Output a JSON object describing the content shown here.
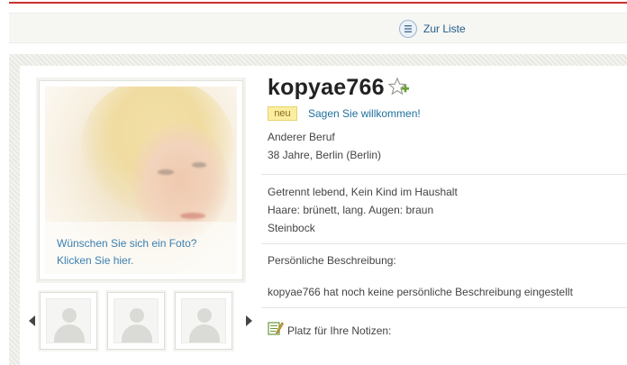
{
  "toolbar": {
    "back_to_list_label": "Zur Liste",
    "icon": "list-icon"
  },
  "profile": {
    "username": "kopyae766",
    "favorite_icon": "star-plus-icon",
    "badge": "neu",
    "welcome_link": "Sagen Sie willkommen!",
    "occupation": "Anderer Beruf",
    "age_location": "38 Jahre, Berlin (Berlin)",
    "family_status": "Getrennt lebend, Kein Kind im Haushalt",
    "appearance": "Haare: brünett, lang. Augen: braun",
    "zodiac": "Steinbock",
    "description_heading": "Persönliche Beschreibung:",
    "description_text": "kopyae766 hat noch keine persönliche Beschreibung eingestellt",
    "notes_label": "Platz für Ihre Notizen:",
    "notes_icon": "notepad-pencil-icon"
  },
  "photo": {
    "cta_line1": "Wünschen Sie sich ein Foto?",
    "cta_line2": "Klicken Sie hier."
  },
  "thumbnails": {
    "count": 3,
    "placeholder_icon": "user-silhouette-icon",
    "prev_icon": "arrow-left-icon",
    "next_icon": "arrow-right-icon"
  },
  "colors": {
    "link": "#1f6f9c",
    "badge_bg": "#fbeea0",
    "accent_line": "#c9302c"
  }
}
